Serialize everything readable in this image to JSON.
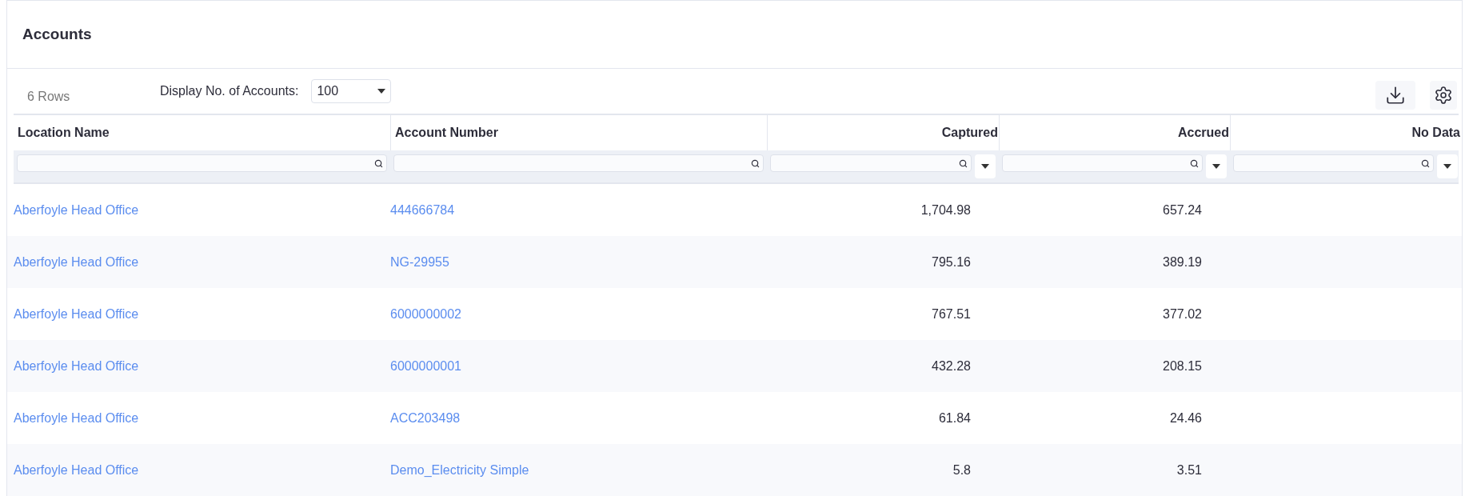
{
  "title": "Accounts",
  "row_count": "6 Rows",
  "display_label": "Display No. of Accounts:",
  "display_select": {
    "value": "100"
  },
  "columns": [
    {
      "label": "Location Name",
      "kind": "text",
      "dropdown": false
    },
    {
      "label": "Account Number",
      "kind": "text",
      "dropdown": false
    },
    {
      "label": "Captured",
      "kind": "numeric",
      "dropdown": true
    },
    {
      "label": "Accrued",
      "kind": "numeric",
      "dropdown": true
    },
    {
      "label": "No Data",
      "kind": "numeric",
      "dropdown": true
    }
  ],
  "rows": [
    {
      "location": "Aberfoyle Head Office",
      "account": "444666784",
      "captured": "1,704.98",
      "accrued": "657.24"
    },
    {
      "location": "Aberfoyle Head Office",
      "account": "NG-29955",
      "captured": "795.16",
      "accrued": "389.19"
    },
    {
      "location": "Aberfoyle Head Office",
      "account": "6000000002",
      "captured": "767.51",
      "accrued": "377.02"
    },
    {
      "location": "Aberfoyle Head Office",
      "account": "6000000001",
      "captured": "432.28",
      "accrued": "208.15"
    },
    {
      "location": "Aberfoyle Head Office",
      "account": "ACC203498",
      "captured": "61.84",
      "accrued": "24.46"
    },
    {
      "location": "Aberfoyle Head Office",
      "account": "Demo_Electricity Simple",
      "captured": "5.8",
      "accrued": "3.51"
    }
  ]
}
